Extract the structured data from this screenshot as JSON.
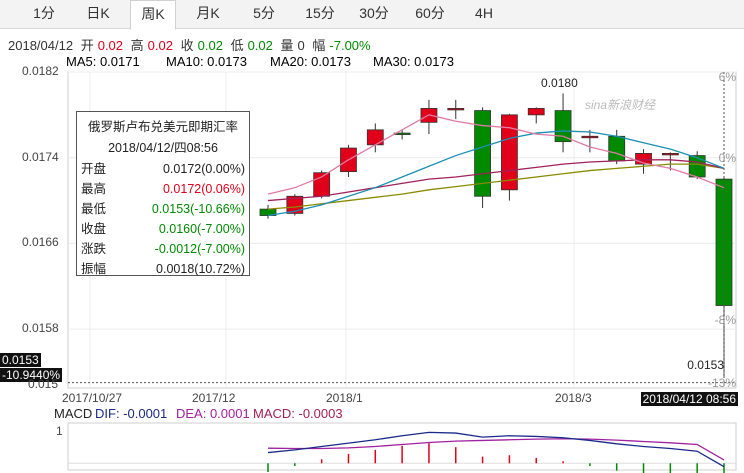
{
  "tabs": [
    {
      "label": "1分",
      "active": false
    },
    {
      "label": "日K",
      "active": false
    },
    {
      "label": "周K",
      "active": true
    },
    {
      "label": "月K",
      "active": false
    },
    {
      "label": "5分",
      "active": false
    },
    {
      "label": "15分",
      "active": false
    },
    {
      "label": "30分",
      "active": false
    },
    {
      "label": "60分",
      "active": false
    },
    {
      "label": "4H",
      "active": false
    }
  ],
  "ohlc": {
    "date": "2018/04/12",
    "open_label": "开",
    "open": "0.02",
    "high_label": "高",
    "high": "0.02",
    "close_label": "收",
    "close": "0.02",
    "low_label": "低",
    "low": "0.02",
    "volume_label": "量",
    "volume": "0",
    "amplitude_label": "幅",
    "amplitude": "-7.00%"
  },
  "ma": [
    {
      "label": "MA5: 0.0171",
      "color": "#e07aa4"
    },
    {
      "label": "MA10: 0.0173",
      "color": "#1a8fb5"
    },
    {
      "label": "MA20: 0.0173",
      "color": "#a0205a"
    },
    {
      "label": "MA30: 0.0173",
      "color": "#8a8a00"
    }
  ],
  "tooltip": {
    "title": "俄罗斯卢布兑美元即期汇率",
    "datetime": "2018/04/12/四08:56",
    "rows": [
      {
        "k": "开盘",
        "v": "0.0172(0.00%)",
        "color": "#222"
      },
      {
        "k": "最高",
        "v": "0.0172(0.06%)",
        "color": "#e0001a"
      },
      {
        "k": "最低",
        "v": "0.0153(-10.66%)",
        "color": "#008a00"
      },
      {
        "k": "收盘",
        "v": "0.0160(-7.00%)",
        "color": "#008a00"
      },
      {
        "k": "涨跌",
        "v": "-0.0012(-7.00%)",
        "color": "#008a00"
      },
      {
        "k": "振幅",
        "v": "0.0018(10.72%)",
        "color": "#222"
      }
    ]
  },
  "watermark": "sina新浪财经",
  "crosshair": {
    "price": "0.0153",
    "pct": "-10.9440%",
    "right_price": "0.0153",
    "time": "2018/04/12 08:56"
  },
  "peak_label": "0.0180",
  "left_extra_label": "0.015",
  "macd": {
    "name": "MACD",
    "dif": "DIF: -0.0001",
    "dea": "DEA: 0.0001",
    "macd": "MACD: -0.0003",
    "tick": "1"
  },
  "chart_data": {
    "type": "candlestick",
    "y_ticks": [
      "0.0182",
      "0.0174",
      "0.0166",
      "0.0158"
    ],
    "y_range": [
      0.01525,
      0.0182
    ],
    "pct_ticks": [
      "6%",
      "0%",
      "-8%",
      "-13%"
    ],
    "x_labels": [
      "2017/10/27",
      "2017/12",
      "2018/1",
      "2018/3"
    ],
    "candles": [
      {
        "o": 0.01692,
        "h": 0.01696,
        "l": 0.01683,
        "c": 0.01686
      },
      {
        "o": 0.01688,
        "h": 0.01706,
        "l": 0.01686,
        "c": 0.01704
      },
      {
        "o": 0.01704,
        "h": 0.01728,
        "l": 0.01702,
        "c": 0.01726
      },
      {
        "o": 0.01727,
        "h": 0.01752,
        "l": 0.01722,
        "c": 0.01749
      },
      {
        "o": 0.01752,
        "h": 0.01772,
        "l": 0.01745,
        "c": 0.01766
      },
      {
        "o": 0.01763,
        "h": 0.01766,
        "l": 0.01757,
        "c": 0.01762
      },
      {
        "o": 0.01773,
        "h": 0.01794,
        "l": 0.01762,
        "c": 0.01786
      },
      {
        "o": 0.01786,
        "h": 0.01794,
        "l": 0.01776,
        "c": 0.01786
      },
      {
        "o": 0.01784,
        "h": 0.01787,
        "l": 0.01693,
        "c": 0.01704
      },
      {
        "o": 0.0171,
        "h": 0.01781,
        "l": 0.017,
        "c": 0.0178
      },
      {
        "o": 0.0178,
        "h": 0.01787,
        "l": 0.01772,
        "c": 0.01786
      },
      {
        "o": 0.01784,
        "h": 0.018,
        "l": 0.01745,
        "c": 0.01755
      },
      {
        "o": 0.0176,
        "h": 0.01766,
        "l": 0.01745,
        "c": 0.0176
      },
      {
        "o": 0.0176,
        "h": 0.01766,
        "l": 0.01734,
        "c": 0.01737
      },
      {
        "o": 0.01734,
        "h": 0.01748,
        "l": 0.01725,
        "c": 0.01744
      },
      {
        "o": 0.01744,
        "h": 0.01745,
        "l": 0.01728,
        "c": 0.01744
      },
      {
        "o": 0.01742,
        "h": 0.01746,
        "l": 0.0172,
        "c": 0.01722
      },
      {
        "o": 0.0172,
        "h": 0.01722,
        "l": 0.01535,
        "c": 0.01602
      }
    ],
    "ma5": [
      0.01706,
      0.01712,
      0.01722,
      0.01738,
      0.01752,
      0.01766,
      0.0178,
      0.01774,
      0.0177,
      0.01768,
      0.01762,
      0.0176,
      0.0175,
      0.01744,
      0.01735,
      0.0173,
      0.01722,
      0.01712
    ],
    "ma10": [
      0.01686,
      0.0169,
      0.01696,
      0.01704,
      0.01712,
      0.01722,
      0.01732,
      0.01742,
      0.0175,
      0.01758,
      0.01763,
      0.01765,
      0.01764,
      0.0176,
      0.01754,
      0.01748,
      0.0174,
      0.0173
    ],
    "ma20": [
      0.017,
      0.01702,
      0.01704,
      0.01708,
      0.01712,
      0.01716,
      0.0172,
      0.01722,
      0.01725,
      0.01728,
      0.01731,
      0.01734,
      0.01736,
      0.01737,
      0.01738,
      0.01738,
      0.01736,
      0.0173
    ],
    "ma30": [
      0.01692,
      0.01694,
      0.01697,
      0.017,
      0.01703,
      0.01706,
      0.0171,
      0.01713,
      0.01716,
      0.01719,
      0.01722,
      0.01725,
      0.01728,
      0.0173,
      0.01732,
      0.01734,
      0.01734,
      0.0173
    ],
    "macd_dif": [
      0.00032,
      0.0004,
      0.0005,
      0.0006,
      0.0007,
      0.00082,
      0.00092,
      0.0009,
      0.00078,
      0.00082,
      0.0008,
      0.00076,
      0.00068,
      0.00058,
      0.0005,
      0.00044,
      0.00036,
      -0.0001
    ],
    "macd_dea": [
      0.00045,
      0.00044,
      0.00044,
      0.00046,
      0.0005,
      0.00056,
      0.00062,
      0.00066,
      0.00068,
      0.0007,
      0.00072,
      0.00073,
      0.00072,
      0.00069,
      0.00065,
      0.00061,
      0.00056,
      0.0001
    ],
    "macd_range": [
      -0.0002,
      0.0012
    ]
  }
}
